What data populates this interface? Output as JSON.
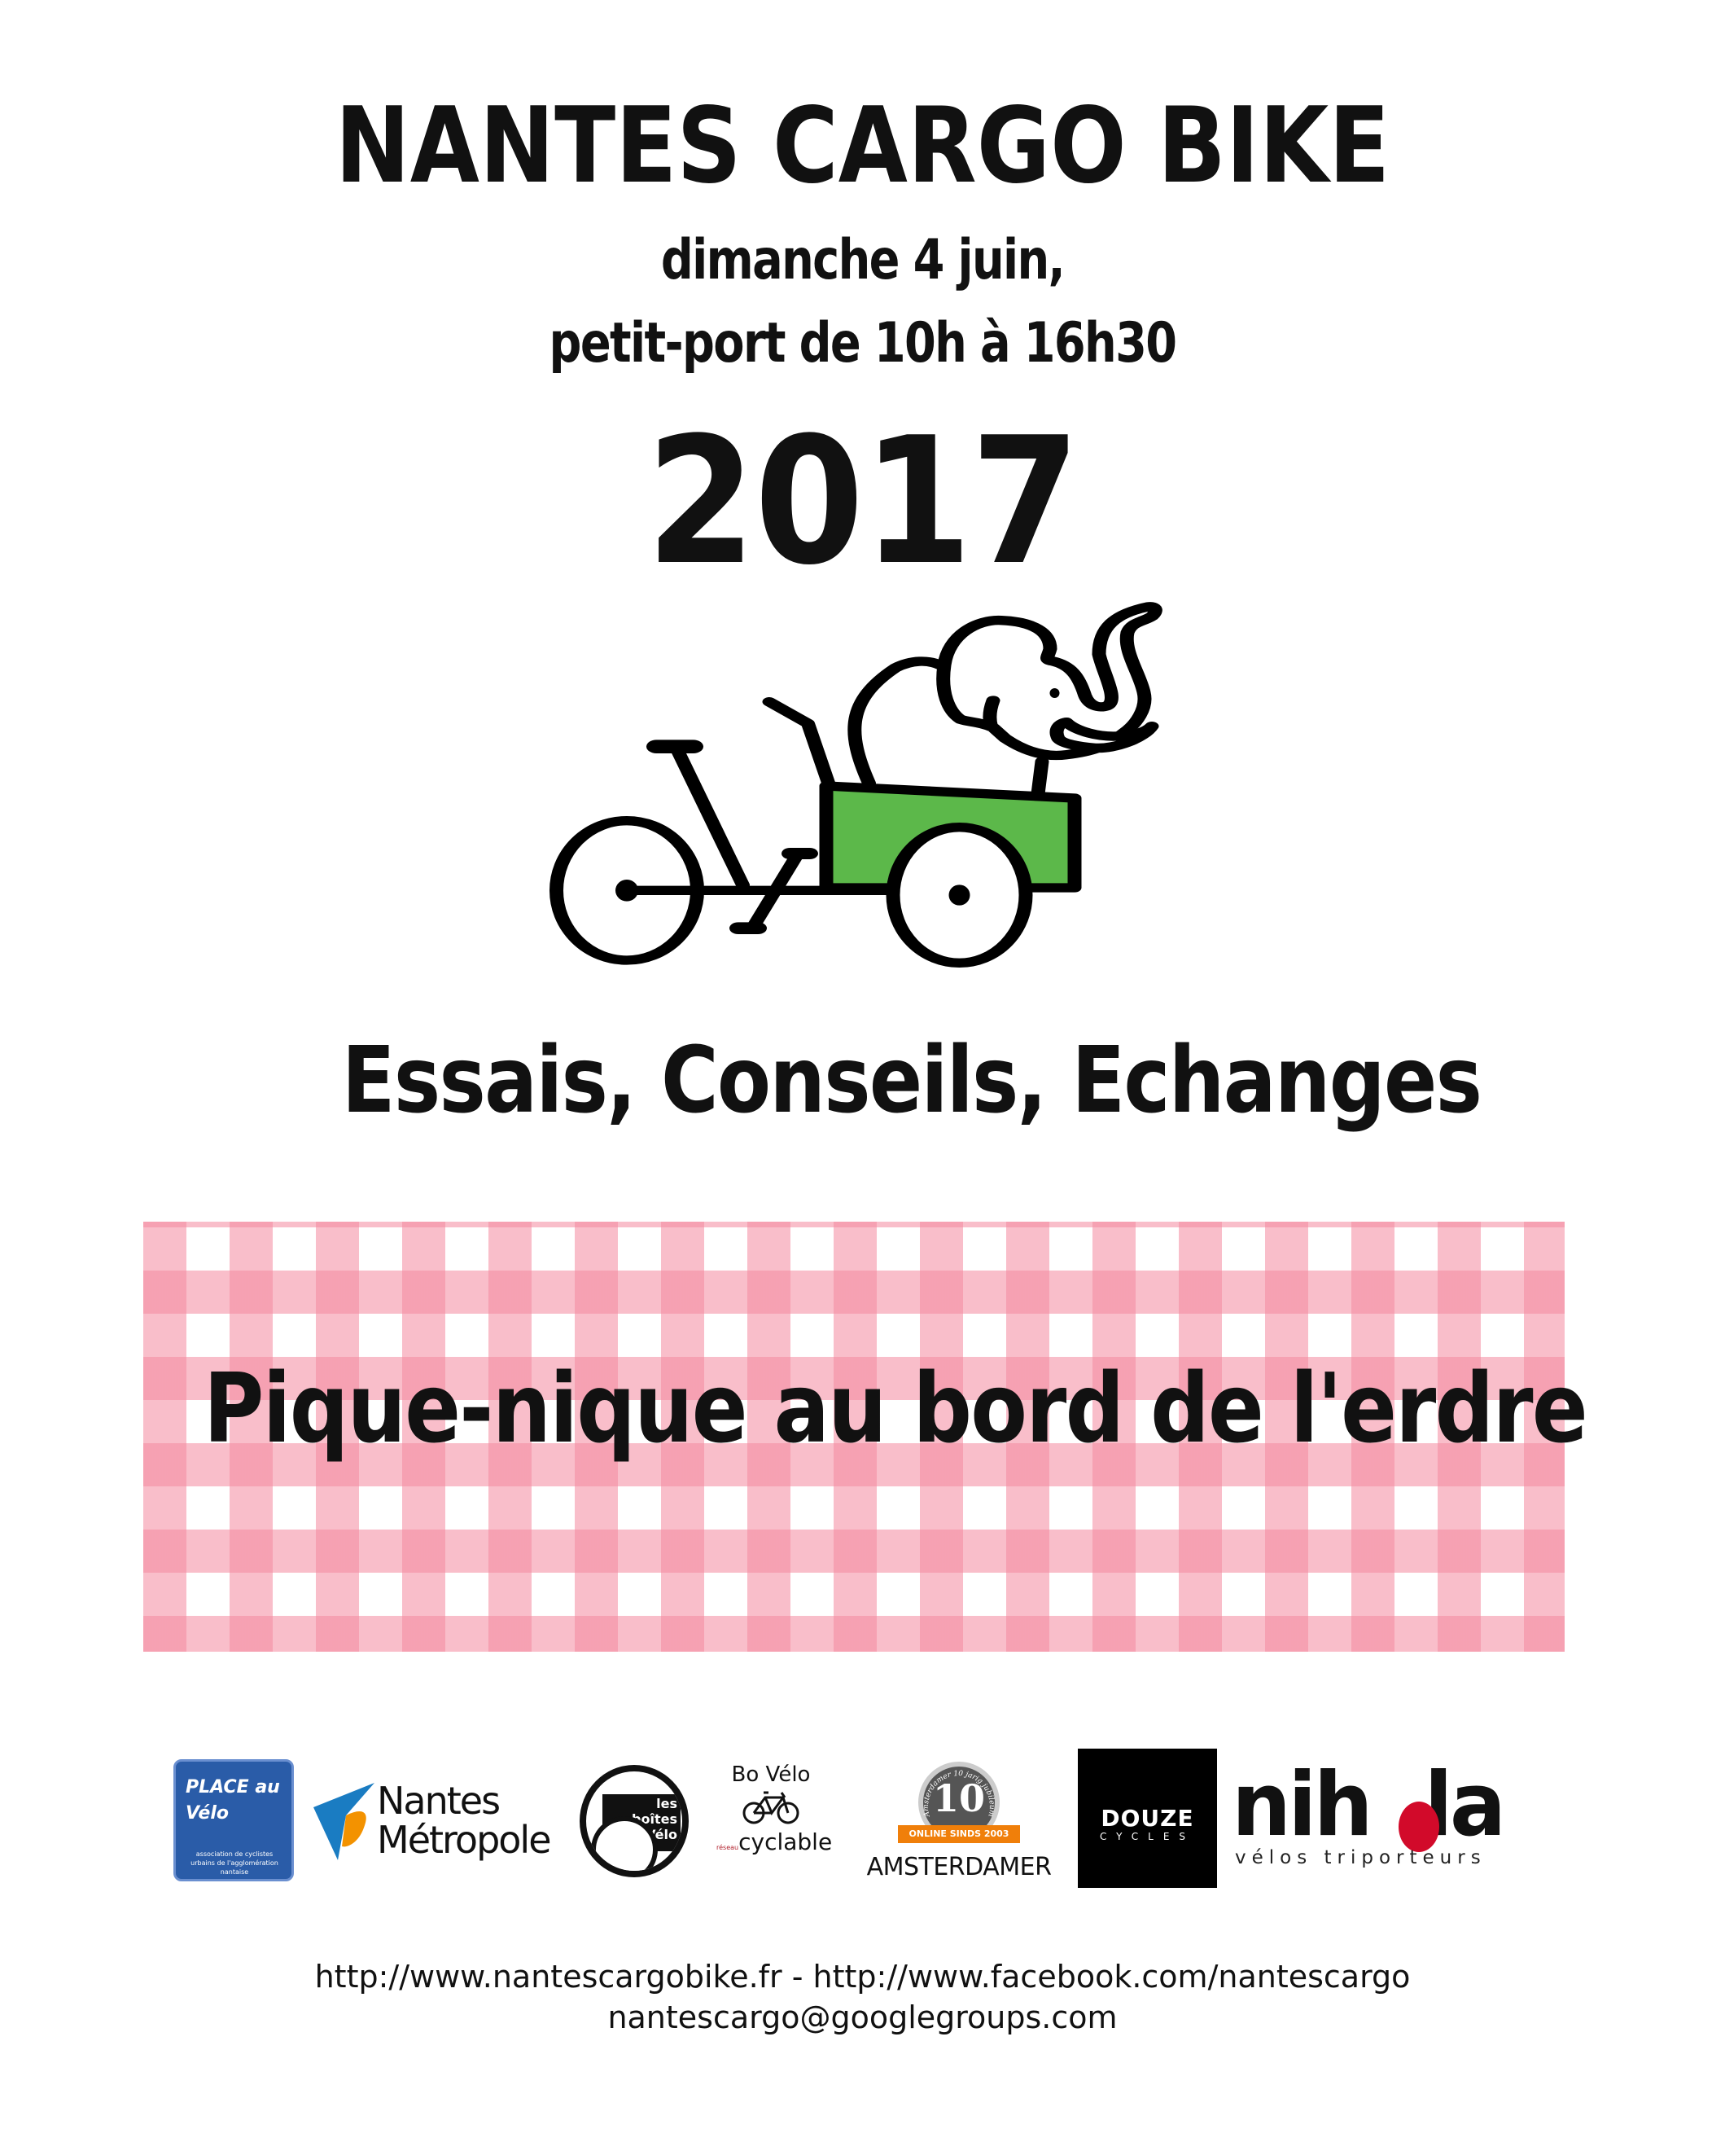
{
  "header": {
    "title": "NANTES CARGO BIKE",
    "date_line": "dimanche 4 juin,",
    "place_line": "petit-port de 10h à 16h30",
    "year": "2017"
  },
  "illustration": {
    "icon": "cargo-bike-with-elephant-icon",
    "box_color": "#5cb84a"
  },
  "tagline": "Essais, Conseils, Echanges",
  "picnic": {
    "text": "Pique-nique au bord de l'erdre",
    "pattern_color": "#f4899f"
  },
  "sponsors": [
    {
      "name": "PLACE au Vélo",
      "sub": "association de cyclistes urbains de l'agglomération nantaise",
      "color": "#2a5ca8"
    },
    {
      "name_line1": "Nantes",
      "name_line2": "Métropole"
    },
    {
      "name": "les boîtes à Vélo"
    },
    {
      "name": "Bo Vélo",
      "sub": "cyclable",
      "sub_prefix": "réseau"
    },
    {
      "name": "AMSTERDAMER",
      "badge_number": "10",
      "badge_text": "ONLINE SINDS 2003",
      "badge_ring": "Amsterdamer 10 jarig jubileum"
    },
    {
      "name": "DOUZE",
      "sub": "CYCLES"
    },
    {
      "name": "nihola",
      "sub": "vélos triporteurs"
    }
  ],
  "footer": {
    "links": "http://www.nantescargobike.fr - http://www.facebook.com/nantescargo",
    "email": "nantescargo@googlegroups.com"
  }
}
